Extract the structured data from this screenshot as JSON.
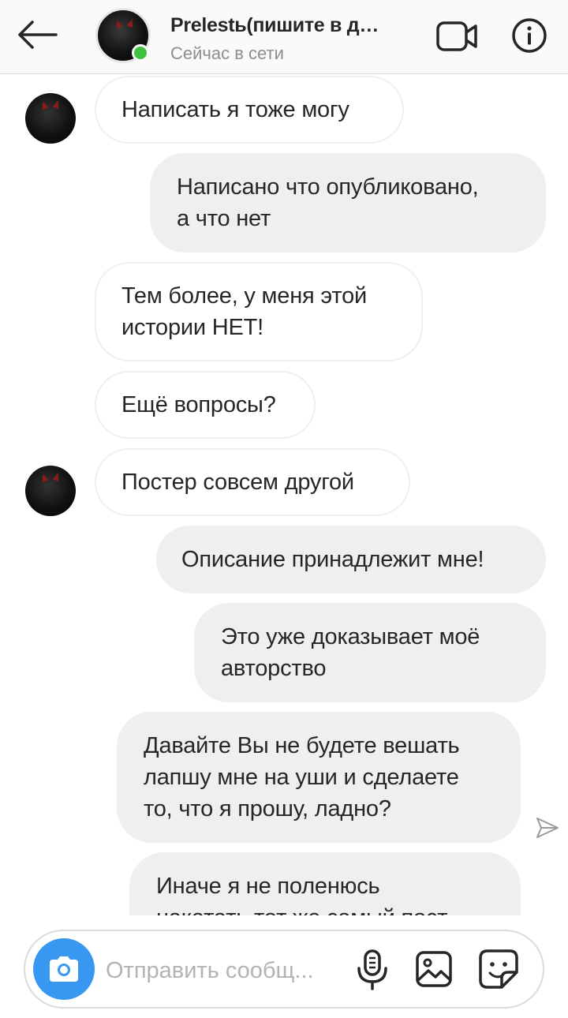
{
  "header": {
    "back_icon": "arrow-left-icon",
    "contact_name": "Prelestь(пишите в д…",
    "status": "Сейчас в сети",
    "online_color": "#3fc13f",
    "video_icon": "video-camera-icon",
    "info_icon": "info-icon"
  },
  "messages": [
    {
      "direction": "incoming",
      "show_avatar": true,
      "lines": [
        "Написать я тоже могу"
      ]
    },
    {
      "direction": "outgoing",
      "lines": [
        "Написано что опубликовано,",
        "а что нет"
      ]
    },
    {
      "direction": "incoming",
      "show_avatar": false,
      "lines": [
        "Тем более, у меня этой",
        "истории НЕТ!"
      ]
    },
    {
      "direction": "incoming",
      "show_avatar": false,
      "lines": [
        "Ещё вопросы?"
      ]
    },
    {
      "direction": "incoming",
      "show_avatar": true,
      "lines": [
        "Постер совсем другой"
      ]
    },
    {
      "direction": "outgoing",
      "lines": [
        "Описание принадлежит мне!"
      ]
    },
    {
      "direction": "outgoing",
      "lines": [
        "Это уже доказывает моё",
        "авторство"
      ]
    },
    {
      "direction": "outgoing",
      "lines": [
        "Давайте Вы не будете вешать",
        "лапшу мне на уши и сделаете",
        "то, что я прошу, ладно?"
      ]
    },
    {
      "direction": "outgoing",
      "lines": [
        "Иначе я не поленюсь",
        "накатать тот же самый пост"
      ]
    }
  ],
  "composer": {
    "placeholder": "Отправить сообщ...",
    "camera_icon": "camera-icon",
    "mic_icon": "microphone-icon",
    "gallery_icon": "image-gallery-icon",
    "sticker_icon": "sticker-icon",
    "accent_color": "#3897f0"
  },
  "colors": {
    "outgoing_bubble": "#efefef",
    "incoming_border": "#efefef",
    "text": "#262626",
    "muted": "#8e8e8e"
  }
}
